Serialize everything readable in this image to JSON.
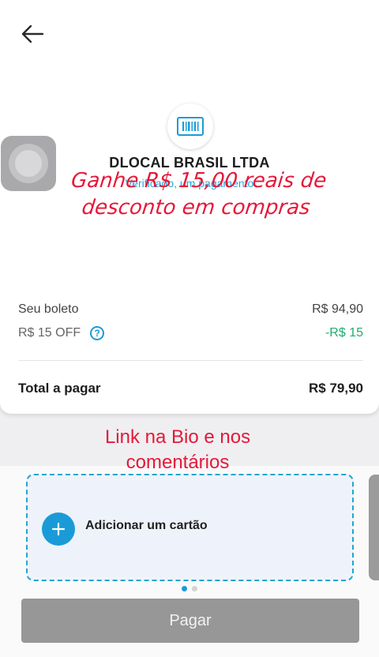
{
  "header": {
    "back_icon": "arrow-left-icon"
  },
  "merchant": {
    "logo_icon": "barcode-icon",
    "name": "DLOCAL BRASIL LTDA",
    "subtitle": "Verificado, um pagamento"
  },
  "promo_overlay": {
    "line1": "Ganhe R$ 15,00 reais de",
    "line2": "desconto em compras"
  },
  "summary": {
    "boleto_label": "Seu boleto",
    "boleto_value": "R$ 94,90",
    "off_label": "R$ 15 OFF",
    "help_icon": "question-circle-icon",
    "help_glyph": "?",
    "off_value": "-R$ 15",
    "total_label": "Total a pagar",
    "total_value": "R$ 79,90"
  },
  "promo_link": {
    "line1": "Link na Bio e nos",
    "line2": "comentários"
  },
  "add_card": {
    "icon": "plus-icon",
    "label": "Adicionar um cartão"
  },
  "carousel": {
    "total": 2,
    "active_index": 0
  },
  "pay_button": {
    "label": "Pagar"
  },
  "colors": {
    "accent": "#1a9bd7",
    "discount": "#1fae6f",
    "promo_red": "#e5193a",
    "disabled_button": "#979797"
  }
}
